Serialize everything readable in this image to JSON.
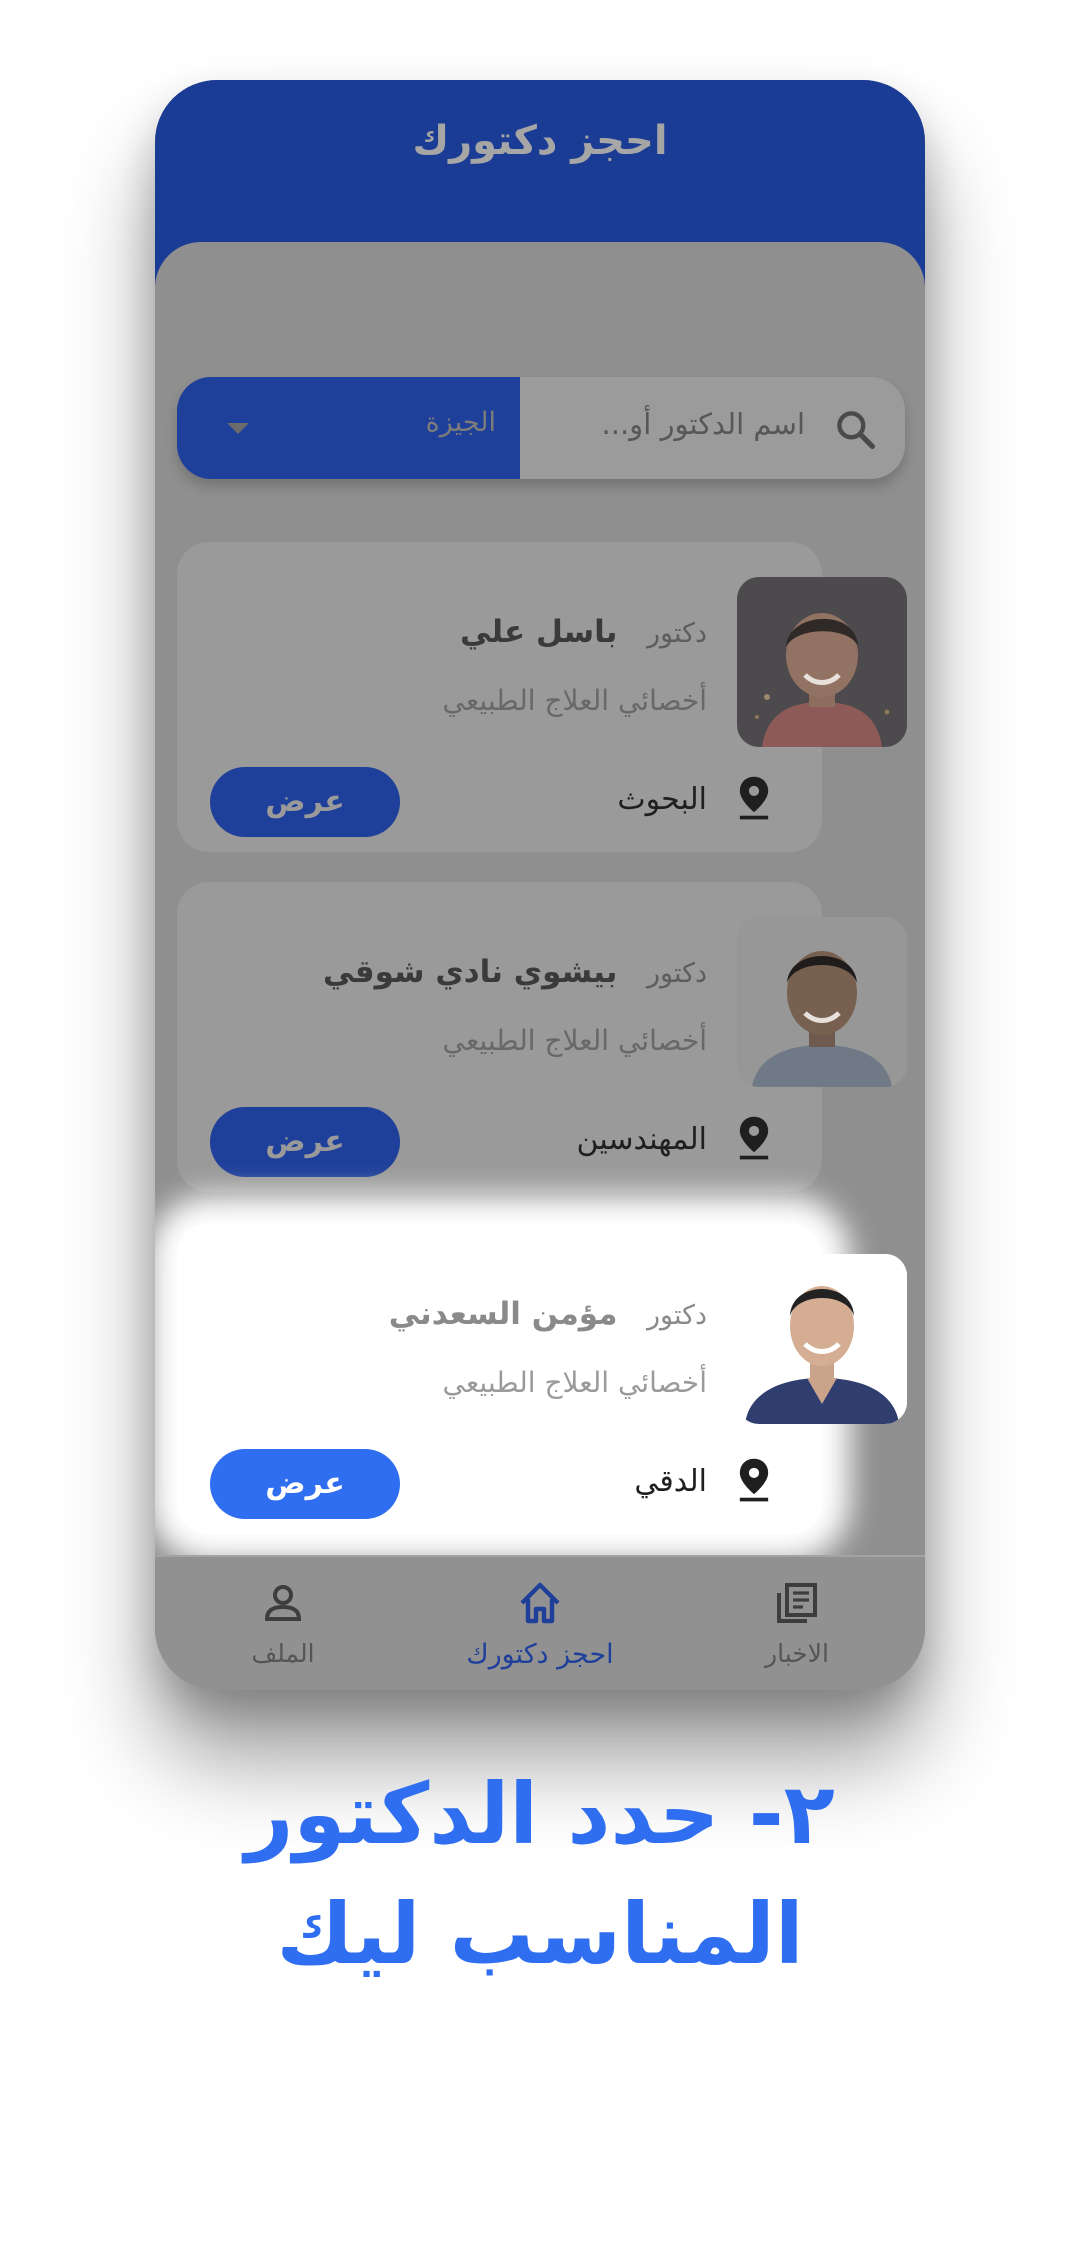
{
  "app": {
    "title": "احجز دكتورك",
    "accent_color": "#2f6ef0",
    "header_color": "#1b3c94"
  },
  "search": {
    "placeholder": "اسم الدكتور أو...",
    "icon": "search-icon",
    "city_selected": "الجيزة"
  },
  "doctors": [
    {
      "prefix": "دكتور",
      "name": "باسل علي",
      "specialty": "أخصائي العلاج الطبيعي",
      "location": "البحوث",
      "button": "عرض"
    },
    {
      "prefix": "دكتور",
      "name": "بيشوي نادي شوقي",
      "specialty": "أخصائي العلاج الطبيعي",
      "location": "المهندسين",
      "button": "عرض"
    },
    {
      "prefix": "دكتور",
      "name": "مؤمن السعدني",
      "specialty": "أخصائي العلاج الطبيعي",
      "location": "الدقي",
      "button": "عرض"
    }
  ],
  "bottom_nav": [
    {
      "label": "الملف",
      "icon": "profile-icon"
    },
    {
      "label": "احجز دكتورك",
      "icon": "home-icon"
    },
    {
      "label": "الاخبار",
      "icon": "news-icon"
    }
  ],
  "caption": {
    "line1": "٢- حدد الدكتور",
    "line2": "المناسب ليك"
  }
}
